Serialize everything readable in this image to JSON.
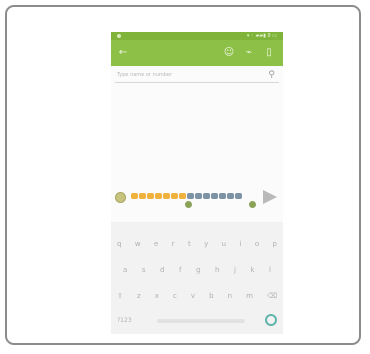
{
  "status_bar": {
    "signal_text": "▾ ◦ ▰▰▮ 8 ▭"
  },
  "app_bar": {
    "back_icon": "arrow-left",
    "actions": [
      {
        "name": "add-contact-icon",
        "glyph": "☺"
      },
      {
        "name": "attach-icon",
        "glyph": "⌁"
      },
      {
        "name": "delete-icon",
        "glyph": "▯"
      }
    ]
  },
  "recipient": {
    "placeholder": "Type name or number",
    "icon": "person-icon"
  },
  "compose": {
    "emoji_icon": "emoji-icon",
    "send_icon": "send-icon"
  },
  "keyboard": {
    "rows": [
      [
        "q",
        "w",
        "e",
        "r",
        "t",
        "y",
        "u",
        "i",
        "o",
        "p"
      ],
      [
        "a",
        "s",
        "d",
        "f",
        "g",
        "h",
        "j",
        "k",
        "l"
      ],
      [
        "⇧",
        "z",
        "x",
        "c",
        "v",
        "b",
        "n",
        "m",
        "⌫"
      ]
    ],
    "bottom": {
      "symbols": "?123",
      "enter_icon": "enter-icon"
    }
  },
  "colors": {
    "accent": "#8dc047",
    "status": "#7fb33a"
  }
}
